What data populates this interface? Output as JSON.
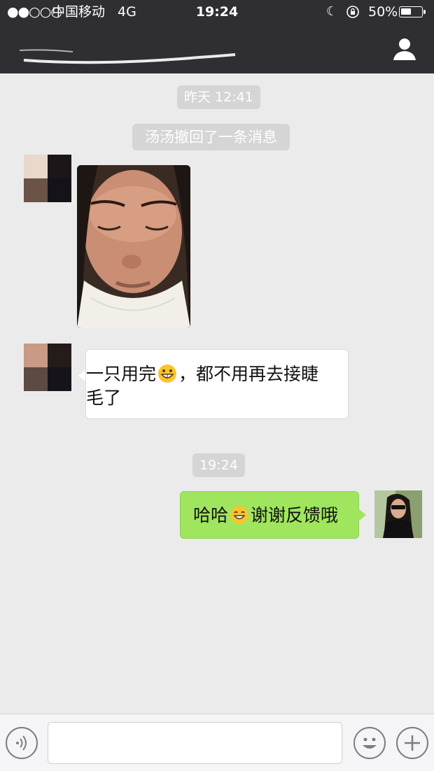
{
  "status_bar": {
    "signal": "●●○○○",
    "carrier": "中国移动",
    "network": "4G",
    "time": "19:24",
    "battery_percent": "50%",
    "battery_level": 0.5
  },
  "nav": {
    "contact_icon": "person-icon"
  },
  "messages": {
    "timestamp_1": "昨天 12:41",
    "recall_notice": "汤汤撤回了一条消息",
    "incoming_text_line1": "一只用完",
    "incoming_text_line1b": "，都不用再去接睫",
    "incoming_text_line2": "毛了",
    "timestamp_2": "19:24",
    "outgoing_text_a": "哈哈",
    "outgoing_text_b": "谢谢反馈哦"
  },
  "input_bar": {
    "voice_icon": "voice-icon",
    "emoji_icon": "emoji-icon",
    "plus_icon": "plus-icon",
    "placeholder": ""
  },
  "colors": {
    "nav_bg": "#2f2f33",
    "chat_bg": "#ebebeb",
    "outgoing_bubble": "#9fe65e",
    "incoming_bubble": "#ffffff",
    "pill_bg": "#d5d5d5"
  }
}
